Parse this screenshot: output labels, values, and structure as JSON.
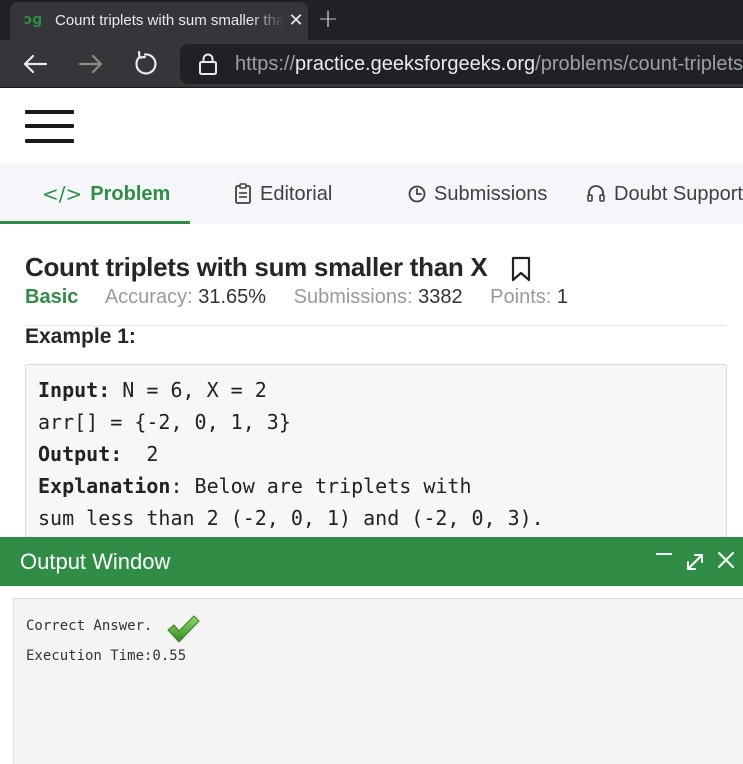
{
  "browser": {
    "tab_title": "Count triplets with sum smaller than X",
    "tab_favicon": "gfg-logo-icon",
    "url_scheme": "https://",
    "url_host": "practice.geeksforgeeks.org",
    "url_path": "/problems/count-triplets-with-sum-smaller-than-x"
  },
  "problem_tabs": [
    {
      "label": "Problem",
      "icon": "code-icon",
      "active": true
    },
    {
      "label": "Editorial",
      "icon": "document-icon",
      "active": false
    },
    {
      "label": "Submissions",
      "icon": "clock-icon",
      "active": false
    },
    {
      "label": "Doubt Support",
      "icon": "headset-icon",
      "active": false
    }
  ],
  "problem": {
    "title": "Count triplets with sum smaller than X",
    "difficulty": "Basic",
    "accuracy_label": "Accuracy:",
    "accuracy_value": "31.65%",
    "submissions_label": "Submissions:",
    "submissions_value": "3382",
    "points_label": "Points:",
    "points_value": "1",
    "example_heading": "Example 1:",
    "example": {
      "input_label": "Input:",
      "input_value": " N = 6, X = 2",
      "arr_line": "arr[] = {-2, 0, 1, 3}",
      "output_label": "Output:",
      "output_value": "  2",
      "explanation_label": "Explanation",
      "explanation_value": ": Below are triplets with",
      "explanation_line2": "sum less than 2 (-2, 0, 1) and (-2, 0, 3)."
    }
  },
  "output_window": {
    "title": "Output Window",
    "result": "Correct Answer.",
    "execution_time": "Execution Time:0.55"
  },
  "colors": {
    "accent_green": "#2f8d46",
    "browser_dark": "#202124",
    "browser_toolbar": "#35363a"
  }
}
